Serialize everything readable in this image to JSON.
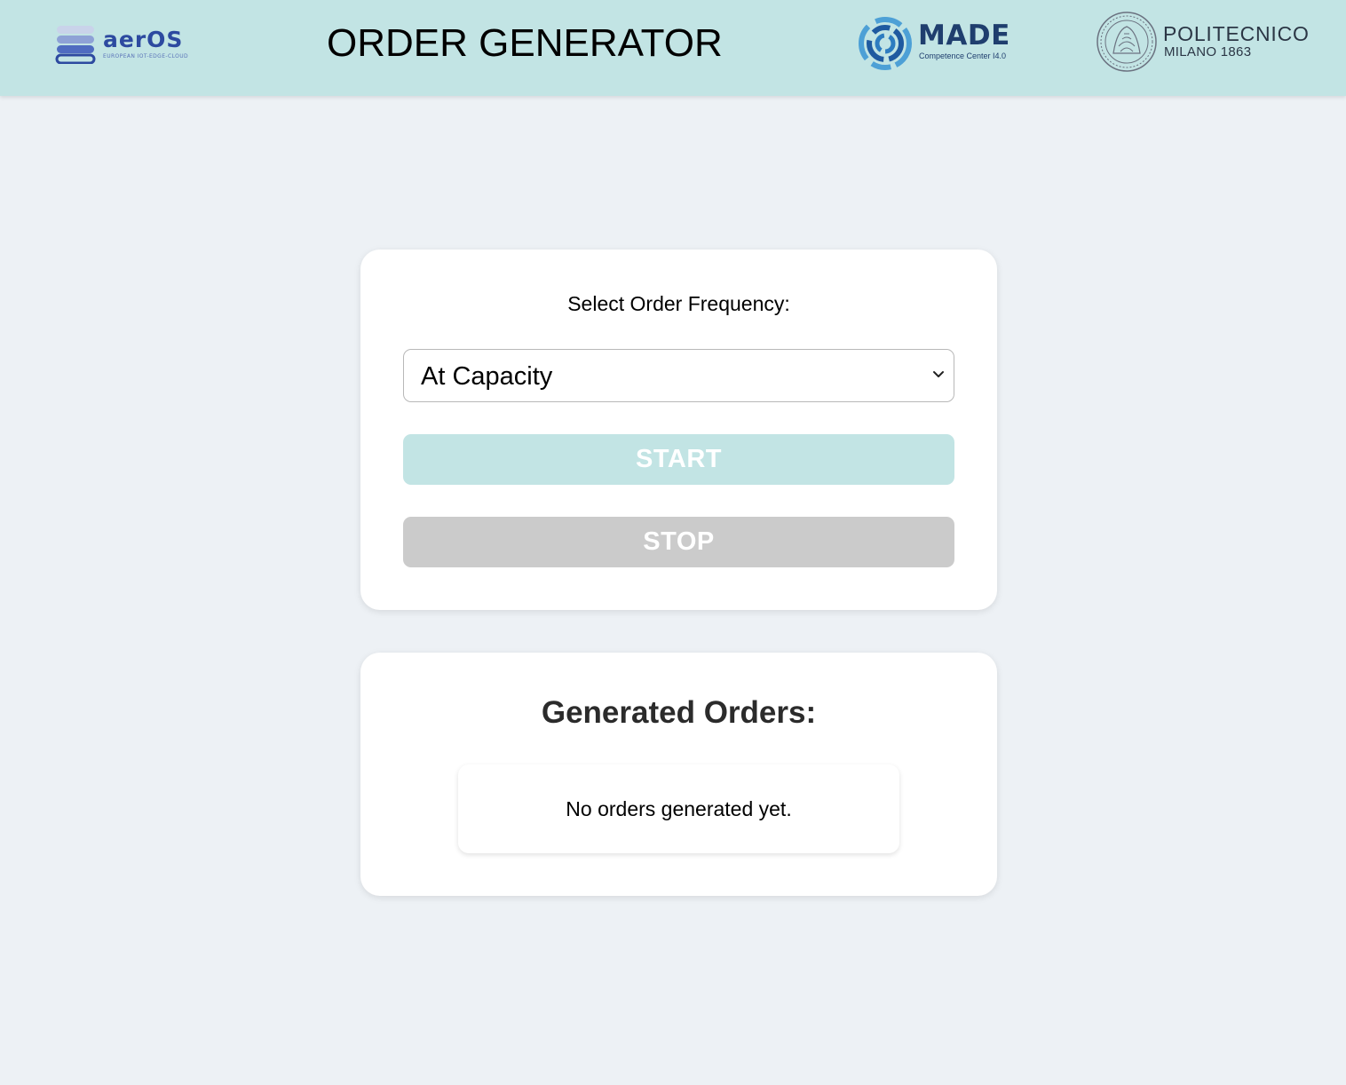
{
  "header": {
    "title": "ORDER GENERATOR",
    "logos": {
      "aeros": {
        "name": "aerOS",
        "tagline": "EUROPEAN IOT-EDGE-CLOUD"
      },
      "made": {
        "name": "MADE",
        "tagline": "Competence Center I4.0"
      },
      "polimi": {
        "name": "POLITECNICO",
        "subtitle": "MILANO 1863"
      }
    },
    "background_color": "#c2e4e4"
  },
  "control": {
    "frequency_label": "Select Order Frequency:",
    "frequency_selected": "At Capacity",
    "start_label": "START",
    "stop_label": "STOP",
    "start_color": "#c2e4e4",
    "stop_color": "#cbcbcb"
  },
  "orders": {
    "title": "Generated Orders:",
    "empty_message": "No orders generated yet."
  },
  "page_background": "#edf1f5"
}
